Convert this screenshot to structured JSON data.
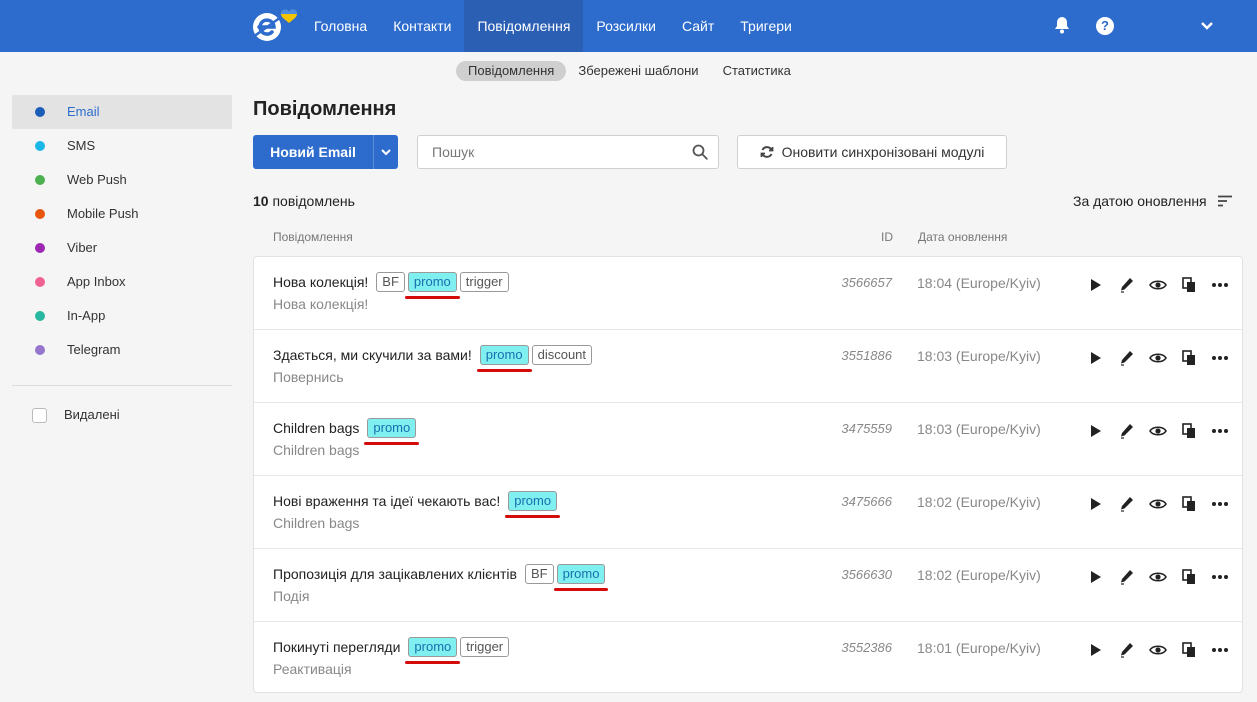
{
  "topbar": {
    "nav": [
      {
        "label": "Головна"
      },
      {
        "label": "Контакти"
      },
      {
        "label": "Повідомлення",
        "active": true
      },
      {
        "label": "Розсилки"
      },
      {
        "label": "Сайт"
      },
      {
        "label": "Тригери"
      }
    ],
    "help_label": "?",
    "accent_color": "#2d6ccd"
  },
  "subnav": [
    {
      "label": "Повідомлення",
      "active": true
    },
    {
      "label": "Збережені шаблони"
    },
    {
      "label": "Статистика"
    }
  ],
  "sidebar": {
    "channels": [
      {
        "label": "Email",
        "color": "#1a5eb8",
        "active": true
      },
      {
        "label": "SMS",
        "color": "#1ab6e8"
      },
      {
        "label": "Web Push",
        "color": "#4caf50"
      },
      {
        "label": "Mobile Push",
        "color": "#e8550d"
      },
      {
        "label": "Viber",
        "color": "#9c27b0"
      },
      {
        "label": "App Inbox",
        "color": "#f06292"
      },
      {
        "label": "In-App",
        "color": "#26b8a0"
      },
      {
        "label": "Telegram",
        "color": "#9575cd"
      }
    ],
    "deleted_label": "Видалені"
  },
  "main": {
    "title": "Повідомлення",
    "new_button_label": "Новий Email",
    "search_placeholder": "Пошук",
    "sync_button_label": "Оновити синхронізовані модулі",
    "count_number": "10",
    "count_label": "повідомлень",
    "sort_label": "За датою оновлення",
    "columns": {
      "message": "Повідомлення",
      "id": "ID",
      "date": "Дата оновлення"
    }
  },
  "messages": [
    {
      "title": "Нова колекція!",
      "tags": [
        {
          "t": "BF"
        },
        {
          "t": "promo",
          "hl": true
        },
        {
          "t": "trigger"
        }
      ],
      "subtitle": "Нова колекція!",
      "id": "3566657",
      "date": "18:04 (Europe/Kyiv)"
    },
    {
      "title": "Здається, ми скучили за вами!",
      "tags": [
        {
          "t": "promo",
          "hl": true
        },
        {
          "t": "discount"
        }
      ],
      "subtitle": "Повернись",
      "id": "3551886",
      "date": "18:03 (Europe/Kyiv)"
    },
    {
      "title": "Children bags",
      "tags": [
        {
          "t": "promo",
          "hl": true
        }
      ],
      "subtitle": "Children bags",
      "id": "3475559",
      "date": "18:03 (Europe/Kyiv)"
    },
    {
      "title": "Нові враження та ідеї чекають вас!",
      "tags": [
        {
          "t": "promo",
          "hl": true
        }
      ],
      "subtitle": "Children bags",
      "id": "3475666",
      "date": "18:02 (Europe/Kyiv)"
    },
    {
      "title": "Пропозиція для зацікавлених клієнтів",
      "tags": [
        {
          "t": "BF"
        },
        {
          "t": "promo",
          "hl": true
        }
      ],
      "subtitle": "Подія",
      "id": "3566630",
      "date": "18:02 (Europe/Kyiv)"
    },
    {
      "title": "Покинуті перегляди",
      "tags": [
        {
          "t": "promo",
          "hl": true
        },
        {
          "t": "trigger"
        }
      ],
      "subtitle": "Реактивація",
      "id": "3552386",
      "date": "18:01 (Europe/Kyiv)"
    }
  ],
  "row_action_icons": [
    "play-icon",
    "edit-icon",
    "preview-icon",
    "copy-icon",
    "more-icon"
  ]
}
